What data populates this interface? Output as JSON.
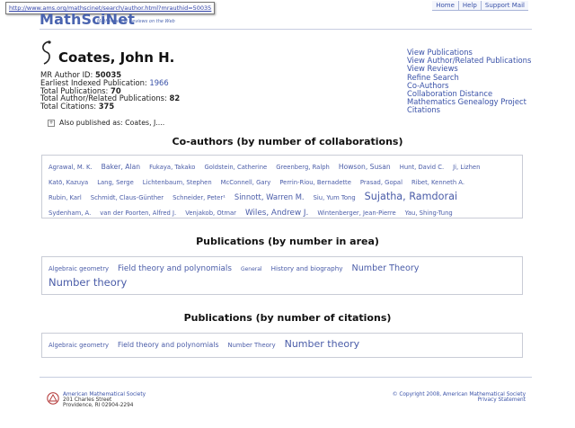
{
  "browser": {
    "status_url": "http://www.ams.org/mathscinet/search/author.html?mrauthid=50035"
  },
  "header": {
    "logo": "MathSciNet",
    "logo_sub": "Mathematical Reviews on the Web",
    "links": [
      "Home",
      "Help",
      "Support Mail"
    ]
  },
  "author": {
    "name": "Coates, John H.",
    "mr_id_label": "MR Author ID:",
    "mr_id": "50035",
    "earliest_label": "Earliest Indexed Publication:",
    "earliest": "1966",
    "total_pub_label": "Total Publications:",
    "total_pub": "70",
    "total_related_label": "Total Author/Related Publications:",
    "total_related": "82",
    "total_cit_label": "Total Citations:",
    "total_cit": "375",
    "also_published": "Also published as: Coates, J...."
  },
  "right_links": [
    "View Publications",
    "View Author/Related Publications",
    "View Reviews",
    "Refine Search",
    "Co-Authors",
    "Collaboration Distance",
    "Mathematics Genealogy Project",
    "Citations"
  ],
  "coauthors": {
    "title": "Co-authors (by number of collaborations)",
    "rows": [
      [
        {
          "name": "Agrawal, M. K.",
          "size": 6.8
        },
        {
          "name": "Baker, Alan",
          "size": 7.6
        },
        {
          "name": "Fukaya, Takako",
          "size": 6.8
        },
        {
          "name": "Goldstein, Catherine",
          "size": 6.8
        },
        {
          "name": "Greenberg, Ralph",
          "size": 6.8
        },
        {
          "name": "Howson, Susan",
          "size": 7.6
        },
        {
          "name": "Hunt, David C.",
          "size": 6.8
        },
        {
          "name": "Ji, Lizhen",
          "size": 6.8
        }
      ],
      [
        {
          "name": "Katō, Kazuya",
          "size": 6.8
        },
        {
          "name": "Lang, Serge",
          "size": 6.8
        },
        {
          "name": "Lichtenbaum, Stephen",
          "size": 6.8
        },
        {
          "name": "McConnell, Gary",
          "size": 6.8
        },
        {
          "name": "Perrin-Riou, Bernadette",
          "size": 6.8
        },
        {
          "name": "Prasad, Gopal",
          "size": 6.8
        },
        {
          "name": "Ribet, Kenneth A.",
          "size": 6.8
        }
      ],
      [
        {
          "name": "Rubin, Karl",
          "size": 6.8
        },
        {
          "name": "Schmidt, Claus-Günther",
          "size": 6.8
        },
        {
          "name": "Schneider, Peter¹",
          "size": 6.8
        },
        {
          "name": "Sinnott, Warren M.",
          "size": 8.4
        },
        {
          "name": "Siu, Yum Tong",
          "size": 6.8
        },
        {
          "name": "Sujatha, Ramdorai",
          "size": 11.2
        }
      ],
      [
        {
          "name": "Sydenham, A.",
          "size": 6.8
        },
        {
          "name": "van der Poorten, Alfred J.",
          "size": 6.8
        },
        {
          "name": "Venjakob, Otmar",
          "size": 6.8
        },
        {
          "name": "Wiles, Andrew J.",
          "size": 8.8
        },
        {
          "name": "Wintenberger, Jean-Pierre",
          "size": 6.8
        },
        {
          "name": "Yau, Shing-Tung",
          "size": 6.8
        }
      ]
    ]
  },
  "areas": {
    "title": "Publications (by number in area)",
    "rows": [
      [
        {
          "name": "Algebraic geometry",
          "size": 6.8
        },
        {
          "name": "Field theory and polynomials",
          "size": 8.8
        },
        {
          "name": "General",
          "size": 6.0
        },
        {
          "name": "History and biography",
          "size": 7.2
        },
        {
          "name": "Number Theory",
          "size": 9.6
        }
      ],
      [
        {
          "name": "Number theory",
          "size": 11.5
        }
      ]
    ]
  },
  "citations": {
    "title": "Publications (by number of citations)",
    "rows": [
      [
        {
          "name": "Algebraic geometry",
          "size": 6.8
        },
        {
          "name": "Field theory and polynomials",
          "size": 7.8
        },
        {
          "name": "Number Theory",
          "size": 6.8
        },
        {
          "name": "Number theory",
          "size": 11.0
        }
      ]
    ]
  },
  "footer": {
    "org": "American Mathematical Society",
    "street": "201 Charles Street",
    "city": "Providence, RI 02904-2294",
    "copyright": "© Copyright 2008, American Mathematical Society",
    "privacy": "Privacy Statement"
  }
}
